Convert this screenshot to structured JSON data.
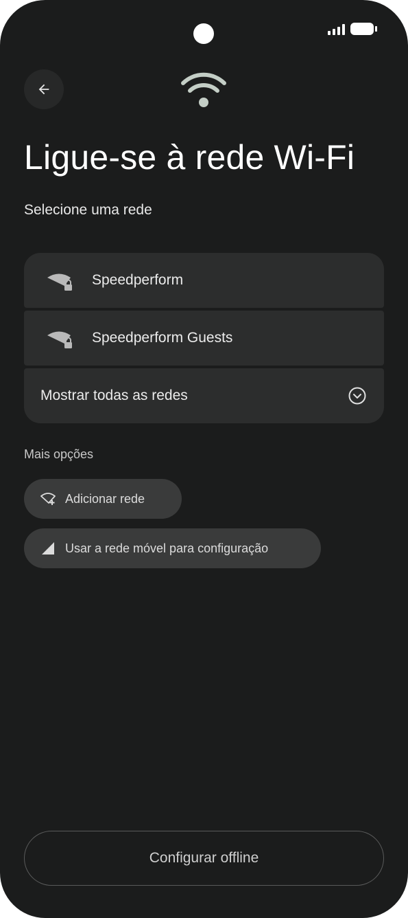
{
  "screen": {
    "title": "Ligue-se à rede Wi-Fi",
    "subtitle": "Selecione uma rede"
  },
  "networks": [
    {
      "name": "Speedperform",
      "icon": "wifi-lock-icon"
    },
    {
      "name": "Speedperform Guests",
      "icon": "wifi-lock-icon"
    }
  ],
  "show_all": {
    "label": "Mostrar todas as redes",
    "icon": "chevron-down-circle-icon"
  },
  "more_options": {
    "label": "Mais opções",
    "add_network": {
      "label": "Adicionar rede",
      "icon": "wifi-add-icon"
    },
    "mobile_network": {
      "label": "Usar a rede móvel para configuração",
      "icon": "cellular-signal-icon"
    }
  },
  "footer": {
    "offline_label": "Configurar offline"
  },
  "colors": {
    "background": "#1b1c1c",
    "card": "#2c2d2d",
    "chip": "#3a3b3b",
    "accent_wifi": "#c4cec6"
  }
}
